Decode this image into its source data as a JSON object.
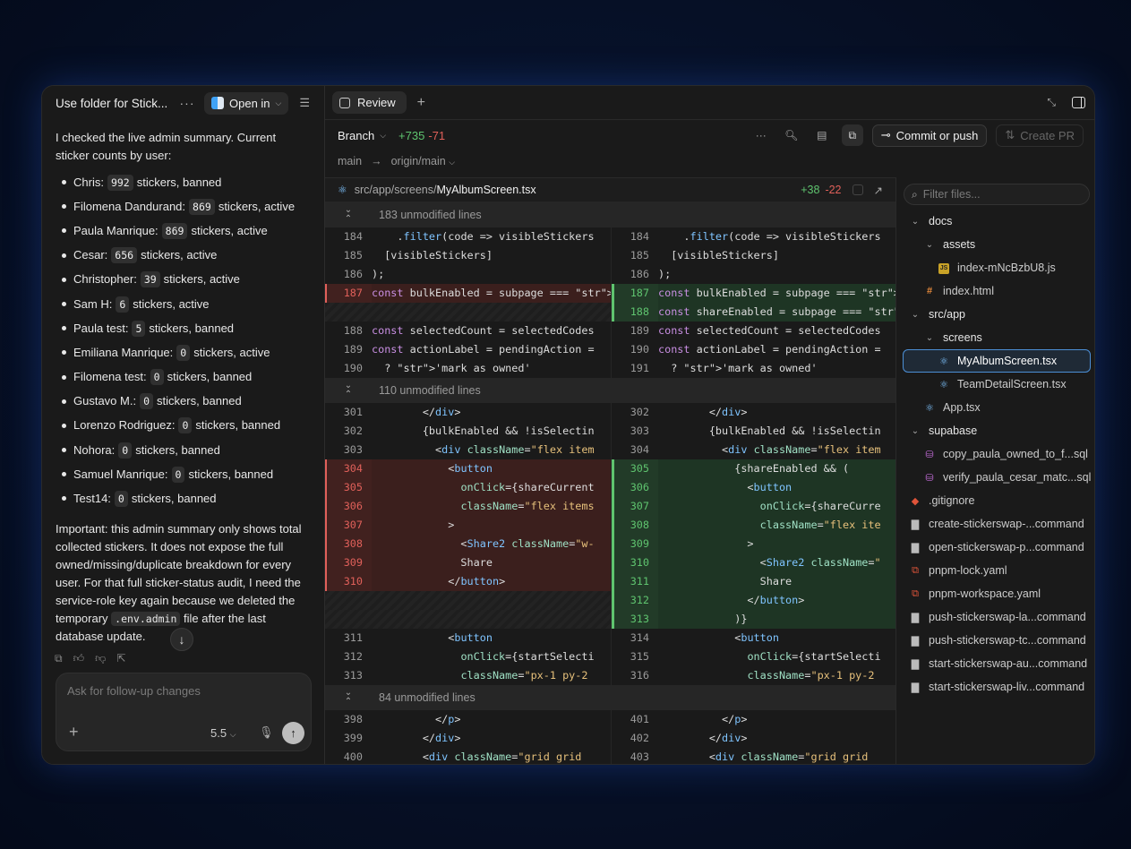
{
  "left": {
    "folder_title": "Use folder for Stick...",
    "open_in_label": "Open in",
    "intro": "I checked the live admin summary. Current sticker counts by user:",
    "users": [
      {
        "name": "Chris:",
        "count": "992",
        "status": "stickers, banned"
      },
      {
        "name": "Filomena Dandurand:",
        "count": "869",
        "status": "stickers, active"
      },
      {
        "name": "Paula Manrique:",
        "count": "869",
        "status": "stickers, active"
      },
      {
        "name": "Cesar:",
        "count": "656",
        "status": "stickers, active"
      },
      {
        "name": "Christopher:",
        "count": "39",
        "status": "stickers, active"
      },
      {
        "name": "Sam H:",
        "count": "6",
        "status": "stickers, active"
      },
      {
        "name": "Paula test:",
        "count": "5",
        "status": "stickers, banned"
      },
      {
        "name": "Emiliana Manrique:",
        "count": "0",
        "status": "stickers, active"
      },
      {
        "name": "Filomena test:",
        "count": "0",
        "status": "stickers, banned"
      },
      {
        "name": "Gustavo M.:",
        "count": "0",
        "status": "stickers, banned"
      },
      {
        "name": "Lorenzo Rodriguez:",
        "count": "0",
        "status": "stickers, banned"
      },
      {
        "name": "Nohora:",
        "count": "0",
        "status": "stickers, banned"
      },
      {
        "name": "Samuel Manrique:",
        "count": "0",
        "status": "stickers, banned"
      },
      {
        "name": "Test14:",
        "count": "0",
        "status": "stickers, banned"
      }
    ],
    "important_pre": "Important: this admin summary only shows total collected stickers. It does not expose the full owned/missing/duplicate breakdown for every user. For that full sticker-status audit, I need the service-role key again because we deleted the temporary",
    "important_code": ".env.admin",
    "important_post": "file after the last database update.",
    "composer_placeholder": "Ask for follow-up changes",
    "model_label": "5.5"
  },
  "tabbar": {
    "tab_label": "Review"
  },
  "branchbar": {
    "branch_label": "Branch",
    "additions": "+735",
    "deletions": "-71",
    "commit_label": "Commit or push",
    "pr_label": "Create PR",
    "base_branch": "main",
    "arrow": "→",
    "target_branch": "origin/main"
  },
  "file_header": {
    "path_dir": "src/app/screens/",
    "path_file": "MyAlbumScreen.tsx",
    "additions": "+38",
    "deletions": "-22"
  },
  "folds": [
    "183 unmodified lines",
    "110 unmodified lines",
    "84 unmodified lines"
  ],
  "filter_placeholder": "Filter files...",
  "tree": [
    {
      "label": "docs",
      "depth": 0,
      "type": "folder"
    },
    {
      "label": "assets",
      "depth": 1,
      "type": "folder"
    },
    {
      "label": "index-mNcBzbU8.js",
      "depth": 2,
      "type": "js"
    },
    {
      "label": "index.html",
      "depth": 1,
      "type": "hash"
    },
    {
      "label": "src/app",
      "depth": 0,
      "type": "folder"
    },
    {
      "label": "screens",
      "depth": 1,
      "type": "folder"
    },
    {
      "label": "MyAlbumScreen.tsx",
      "depth": 2,
      "type": "react",
      "selected": true
    },
    {
      "label": "TeamDetailScreen.tsx",
      "depth": 2,
      "type": "react"
    },
    {
      "label": "App.tsx",
      "depth": 1,
      "type": "react"
    },
    {
      "label": "supabase",
      "depth": 0,
      "type": "folder"
    },
    {
      "label": "copy_paula_owned_to_f...sql",
      "depth": 1,
      "type": "db"
    },
    {
      "label": "verify_paula_cesar_matc...sql",
      "depth": 1,
      "type": "db"
    },
    {
      "label": ".gitignore",
      "depth": 0,
      "type": "git"
    },
    {
      "label": "create-stickerswap-...command",
      "depth": 0,
      "type": "file"
    },
    {
      "label": "open-stickerswap-p...command",
      "depth": 0,
      "type": "file"
    },
    {
      "label": "pnpm-lock.yaml",
      "depth": 0,
      "type": "yaml"
    },
    {
      "label": "pnpm-workspace.yaml",
      "depth": 0,
      "type": "yaml"
    },
    {
      "label": "push-stickerswap-la...command",
      "depth": 0,
      "type": "file"
    },
    {
      "label": "push-stickerswap-tc...command",
      "depth": 0,
      "type": "file"
    },
    {
      "label": "start-stickerswap-au...command",
      "depth": 0,
      "type": "file"
    },
    {
      "label": "start-stickerswap-liv...command",
      "depth": 0,
      "type": "file"
    }
  ],
  "diff_rows": [
    {
      "kind": "fold",
      "text": "183 unmodified lines"
    },
    {
      "l": {
        "n": "184",
        "c": "    .filter(code => visibleStickers"
      },
      "r": {
        "n": "184",
        "c": "    .filter(code => visibleStickers"
      }
    },
    {
      "l": {
        "n": "185",
        "c": "  [visibleStickers]"
      },
      "r": {
        "n": "185",
        "c": "  [visibleStickers]"
      }
    },
    {
      "l": {
        "n": "186",
        "c": ");"
      },
      "r": {
        "n": "186",
        "c": ");"
      }
    },
    {
      "l": {
        "n": "187",
        "c": "const bulkEnabled = subpage === 'mi",
        "t": "del"
      },
      "r": {
        "n": "187",
        "c": "const bulkEnabled = subpage === 'ow",
        "t": "add"
      }
    },
    {
      "l": {
        "n": "",
        "c": "",
        "t": "hatch"
      },
      "r": {
        "n": "188",
        "c": "const shareEnabled = subpage === 'm",
        "t": "add"
      }
    },
    {
      "l": {
        "n": "188",
        "c": "const selectedCount = selectedCodes"
      },
      "r": {
        "n": "189",
        "c": "const selectedCount = selectedCodes"
      }
    },
    {
      "l": {
        "n": "189",
        "c": "const actionLabel = pendingAction ="
      },
      "r": {
        "n": "190",
        "c": "const actionLabel = pendingAction ="
      }
    },
    {
      "l": {
        "n": "190",
        "c": "  ? 'mark as owned'"
      },
      "r": {
        "n": "191",
        "c": "  ? 'mark as owned'"
      }
    },
    {
      "kind": "fold",
      "text": "110 unmodified lines"
    },
    {
      "l": {
        "n": "301",
        "c": "        </div>"
      },
      "r": {
        "n": "302",
        "c": "        </div>"
      }
    },
    {
      "l": {
        "n": "302",
        "c": "        {bulkEnabled && !isSelectin"
      },
      "r": {
        "n": "303",
        "c": "        {bulkEnabled && !isSelectin"
      }
    },
    {
      "l": {
        "n": "303",
        "c": "          <div className=\"flex item"
      },
      "r": {
        "n": "304",
        "c": "          <div className=\"flex item"
      }
    },
    {
      "l": {
        "n": "304",
        "c": "            <button",
        "t": "del"
      },
      "r": {
        "n": "305",
        "c": "            {shareEnabled && (",
        "t": "add"
      }
    },
    {
      "l": {
        "n": "305",
        "c": "              onClick={shareCurrent",
        "t": "del"
      },
      "r": {
        "n": "306",
        "c": "              <button",
        "t": "add"
      }
    },
    {
      "l": {
        "n": "306",
        "c": "              className=\"flex items",
        "t": "del"
      },
      "r": {
        "n": "307",
        "c": "                onClick={shareCurre",
        "t": "add"
      }
    },
    {
      "l": {
        "n": "307",
        "c": "            >",
        "t": "del"
      },
      "r": {
        "n": "308",
        "c": "                className=\"flex ite",
        "t": "add"
      }
    },
    {
      "l": {
        "n": "308",
        "c": "              <Share2 className=\"w-",
        "t": "del"
      },
      "r": {
        "n": "309",
        "c": "              >",
        "t": "add"
      }
    },
    {
      "l": {
        "n": "309",
        "c": "              Share",
        "t": "del"
      },
      "r": {
        "n": "310",
        "c": "                <Share2 className=\"",
        "t": "add"
      }
    },
    {
      "l": {
        "n": "310",
        "c": "            </button>",
        "t": "del"
      },
      "r": {
        "n": "311",
        "c": "                Share",
        "t": "add"
      }
    },
    {
      "l": {
        "n": "",
        "c": "",
        "t": "hatch"
      },
      "r": {
        "n": "312",
        "c": "              </button>",
        "t": "add"
      }
    },
    {
      "l": {
        "n": "",
        "c": "",
        "t": "hatch"
      },
      "r": {
        "n": "313",
        "c": "            )}",
        "t": "add"
      }
    },
    {
      "l": {
        "n": "311",
        "c": "            <button"
      },
      "r": {
        "n": "314",
        "c": "            <button"
      }
    },
    {
      "l": {
        "n": "312",
        "c": "              onClick={startSelecti"
      },
      "r": {
        "n": "315",
        "c": "              onClick={startSelecti"
      }
    },
    {
      "l": {
        "n": "313",
        "c": "              className=\"px-1 py-2"
      },
      "r": {
        "n": "316",
        "c": "              className=\"px-1 py-2"
      }
    },
    {
      "kind": "fold",
      "text": "84 unmodified lines"
    },
    {
      "l": {
        "n": "398",
        "c": "          </p>"
      },
      "r": {
        "n": "401",
        "c": "          </p>"
      }
    },
    {
      "l": {
        "n": "399",
        "c": "        </div>"
      },
      "r": {
        "n": "402",
        "c": "        </div>"
      }
    },
    {
      "l": {
        "n": "400",
        "c": "        <div className=\"grid grid"
      },
      "r": {
        "n": "403",
        "c": "        <div className=\"grid grid"
      }
    }
  ]
}
